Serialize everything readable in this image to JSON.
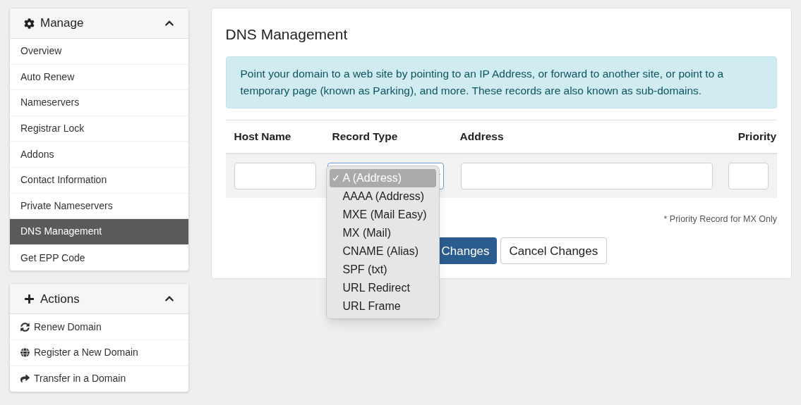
{
  "sidebar": {
    "panels": [
      {
        "title": "Manage",
        "kind": "manage",
        "expanded": true,
        "items": [
          {
            "label": "Overview",
            "selected": false
          },
          {
            "label": "Auto Renew",
            "selected": false
          },
          {
            "label": "Nameservers",
            "selected": false
          },
          {
            "label": "Registrar Lock",
            "selected": false
          },
          {
            "label": "Addons",
            "selected": false
          },
          {
            "label": "Contact Information",
            "selected": false
          },
          {
            "label": "Private Nameservers",
            "selected": false
          },
          {
            "label": "DNS Management",
            "selected": true
          },
          {
            "label": "Get EPP Code",
            "selected": false
          }
        ]
      },
      {
        "title": "Actions",
        "kind": "actions",
        "expanded": true,
        "items": [
          {
            "label": "Renew Domain",
            "selected": false
          },
          {
            "label": "Register a New Domain",
            "selected": false
          },
          {
            "label": "Transfer in a Domain",
            "selected": false
          }
        ]
      }
    ]
  },
  "main": {
    "title": "DNS Management",
    "info": "Point your domain to a web site by pointing to an IP Address, or forward to another site, or point to a temporary page (known as Parking), and more. These records are also known as sub-domains.",
    "table": {
      "columns": [
        "Host Name",
        "Record Type",
        "Address",
        "Priority"
      ]
    },
    "record_type_options": [
      {
        "label": "A (Address)",
        "selected": true
      },
      {
        "label": "AAAA (Address)",
        "selected": false
      },
      {
        "label": "MXE (Mail Easy)",
        "selected": false
      },
      {
        "label": "MX (Mail)",
        "selected": false
      },
      {
        "label": "CNAME (Alias)",
        "selected": false
      },
      {
        "label": "SPF (txt)",
        "selected": false
      },
      {
        "label": "URL Redirect",
        "selected": false
      },
      {
        "label": "URL Frame",
        "selected": false
      }
    ],
    "note": "* Priority Record for MX Only",
    "save_button": "Changes",
    "cancel_button": "Cancel Changes"
  }
}
